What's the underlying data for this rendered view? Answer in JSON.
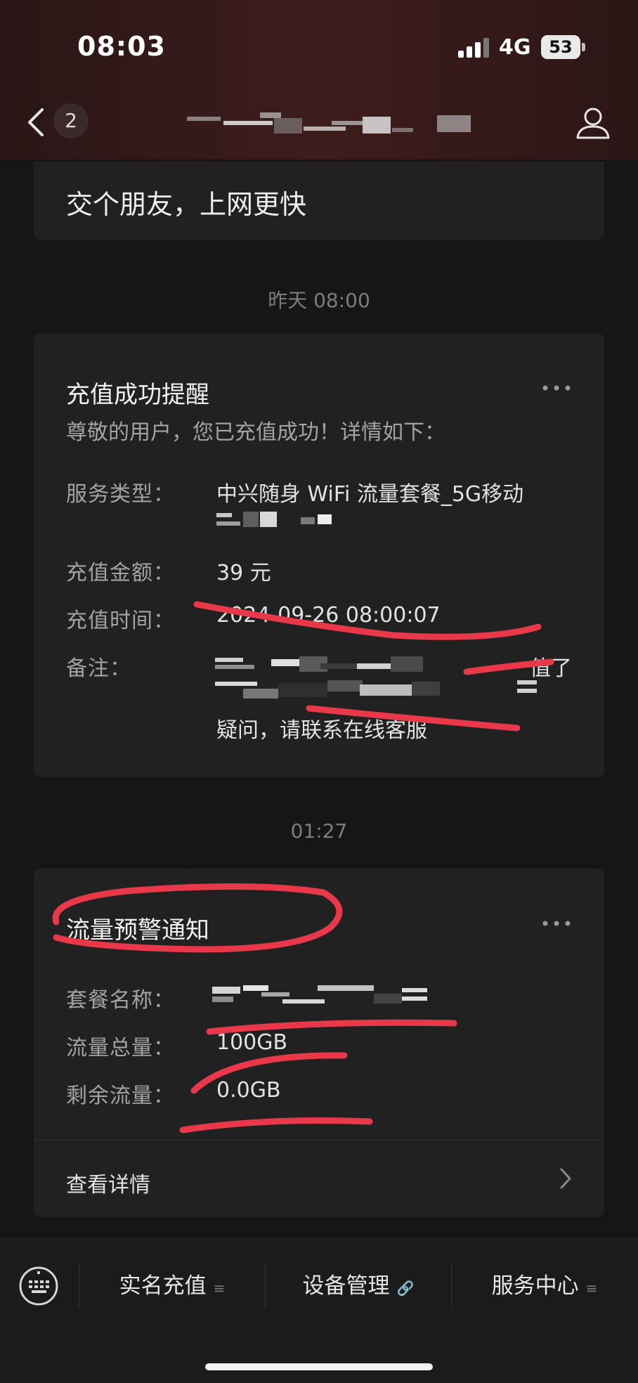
{
  "status_bar": {
    "time": "08:03",
    "network": "4G",
    "battery": "53"
  },
  "header": {
    "unread_count": "2"
  },
  "prev_message": {
    "text": "交个朋友，上网更快"
  },
  "messages": [
    {
      "timestamp": "昨天 08:00",
      "title": "充值成功提醒",
      "subtitle": "尊敬的用户，您已充值成功！详情如下：",
      "rows": [
        {
          "label": "服务类型：",
          "value": "中兴随身 WiFi 流量套餐_5G移动"
        },
        {
          "label": "充值金额：",
          "value": "39 元"
        },
        {
          "label": "充值时间：",
          "value": "2024-09-26 08:00:07"
        },
        {
          "label": "备注：",
          "value_partial_1": "值了",
          "value_partial_2": "疑问，请联系在线客服"
        }
      ]
    },
    {
      "timestamp": "01:27",
      "title": "流量预警通知",
      "rows": [
        {
          "label": "套餐名称：",
          "value": ""
        },
        {
          "label": "流量总量：",
          "value": "100GB"
        },
        {
          "label": "剩余流量：",
          "value": "0.0GB"
        }
      ],
      "link_label": "查看详情"
    }
  ],
  "bottom_menu": [
    {
      "label": "实名充值",
      "icon": "≡"
    },
    {
      "label": "设备管理",
      "icon": "🔗"
    },
    {
      "label": "服务中心",
      "icon": "≡"
    }
  ],
  "colors": {
    "background": "#161616",
    "card": "#212121",
    "annotation": "#e8384a"
  }
}
